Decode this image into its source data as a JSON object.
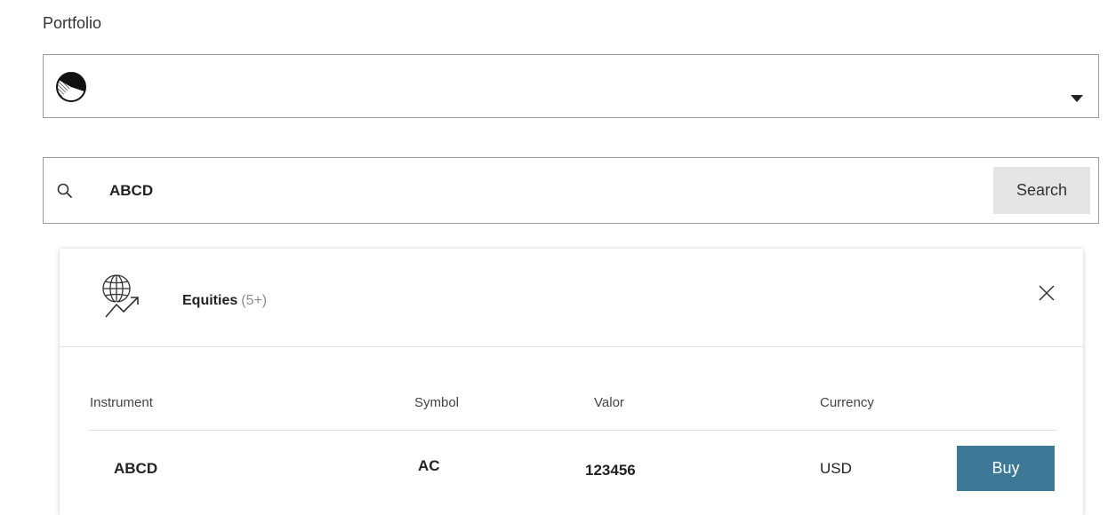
{
  "portfolio": {
    "label": "Portfolio",
    "selected_icon": "pie-chart-icon",
    "dropdown_icon": "caret-down-icon"
  },
  "search": {
    "icon": "search-icon",
    "value": "ABCD",
    "button_label": "Search"
  },
  "results": {
    "category_icon": "globe-trend-icon",
    "category_title": "Equities",
    "category_count": "(5+)",
    "close_icon": "close-icon",
    "columns": [
      "Instrument",
      "Symbol",
      "Valor",
      "Currency"
    ],
    "rows": [
      {
        "instrument": "ABCD",
        "symbol": "AC",
        "valor": "123456",
        "currency": "USD",
        "action_label": "Buy"
      }
    ]
  },
  "colors": {
    "buy_button": "#3d7896",
    "search_button": "#e5e5e5",
    "border": "#9a9a9a"
  }
}
